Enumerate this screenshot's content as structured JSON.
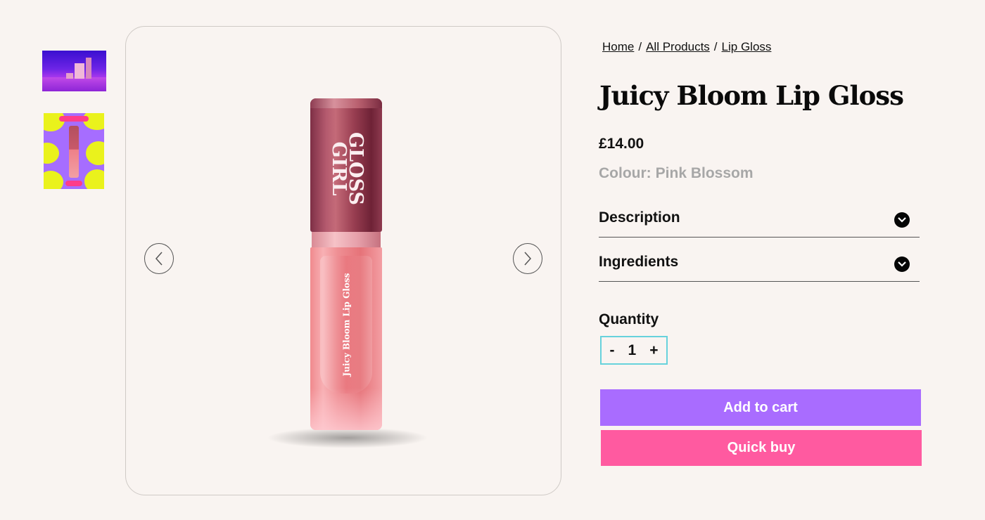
{
  "thumbnails": [
    {
      "alt": "lip-gloss-stage-scene"
    },
    {
      "alt": "lip-gloss-yellow-purple-pattern"
    }
  ],
  "gallery": {
    "prev_icon": "chevron-left-icon",
    "next_icon": "chevron-right-icon",
    "product": {
      "cap_brand": "GLOSS\nGIRL",
      "body_label": "Juicy Bloom Lip Gloss"
    }
  },
  "breadcrumb": {
    "items": [
      "Home",
      "All Products",
      "Lip Gloss"
    ],
    "separator": "/"
  },
  "product": {
    "title": "Juicy Bloom Lip Gloss",
    "price": "£14.00",
    "colour_label": "Colour:",
    "colour_value": "Pink Blossom"
  },
  "accordions": [
    {
      "label": "Description",
      "icon": "chevron-down-icon"
    },
    {
      "label": "Ingredients",
      "icon": "chevron-down-icon"
    }
  ],
  "quantity": {
    "label": "Quantity",
    "minus": "-",
    "value": "1",
    "plus": "+"
  },
  "buttons": {
    "add_to_cart": "Add to cart",
    "quick_buy": "Quick buy"
  },
  "colors": {
    "background": "#f9f4f1",
    "add_to_cart": "#a96cff",
    "quick_buy": "#ff5aa0",
    "quantity_border": "#67d2dc",
    "colour_text": "#a7a7a7"
  }
}
